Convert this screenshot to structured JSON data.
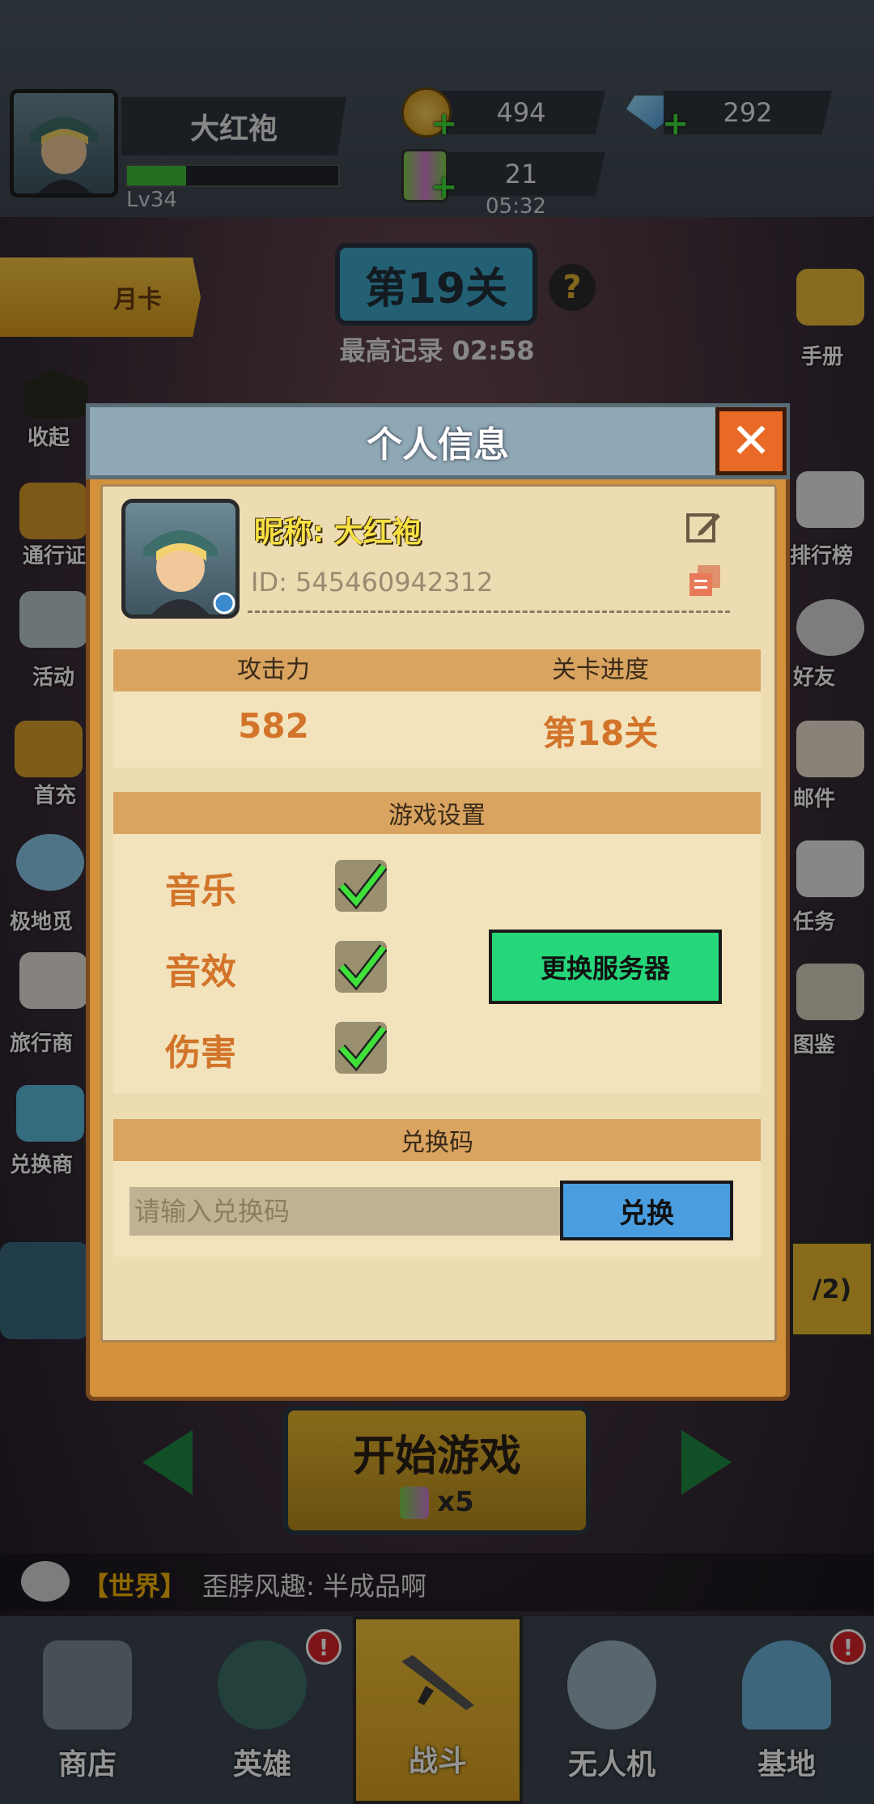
{
  "player": {
    "name": "大红袍",
    "level": "Lv34",
    "xp_fraction": 0.28
  },
  "resources": {
    "coins": "494",
    "gems": "292",
    "energy": "21",
    "energy_timer": "05:32"
  },
  "stage": {
    "monthly_card": "月卡",
    "current_stage": "第19关",
    "help": "?",
    "best_record": "最高记录 02:58"
  },
  "left_menu": [
    "收起",
    "通行证",
    "活动",
    "首充",
    "极地觅",
    "旅行商",
    "兑换商"
  ],
  "right_menu": [
    "手册",
    "排行榜",
    "好友",
    "邮件",
    "任务",
    "图鉴"
  ],
  "right_partial": "/2)",
  "dialog": {
    "title": "个人信息",
    "close": "✕",
    "nickname": "昵称: 大红袍",
    "id_text": "ID: 545460942312",
    "stats": {
      "attack_label": "攻击力",
      "attack_value": "582",
      "progress_label": "关卡进度",
      "progress_value": "第18关"
    },
    "settings": {
      "header": "游戏设置",
      "music": "音乐",
      "sound": "音效",
      "damage": "伤害",
      "server_button": "更换服务器"
    },
    "redeem": {
      "header": "兑换码",
      "placeholder": "请输入兑换码",
      "button": "兑换"
    }
  },
  "start": {
    "label": "开始游戏",
    "cost": "x5"
  },
  "chat": {
    "channel": "【世界】",
    "message": "歪脖风趣: 半成品啊"
  },
  "tabs": [
    {
      "label": "商店"
    },
    {
      "label": "英雄"
    },
    {
      "label": "战斗"
    },
    {
      "label": "无人机"
    },
    {
      "label": "基地"
    }
  ],
  "badges": [
    "!",
    "!"
  ],
  "colors": {
    "accent_orange": "#d2742a",
    "server_green": "#26d67a",
    "redeem_blue": "#4a9ee0",
    "nick_yellow": "#f7e042"
  }
}
